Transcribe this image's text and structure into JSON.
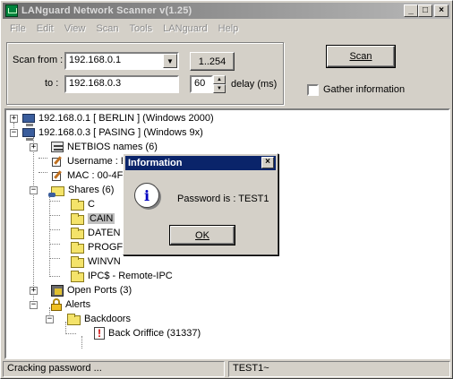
{
  "window": {
    "title": "LANguard Network Scanner v(1.25)"
  },
  "menu": [
    "File",
    "Edit",
    "View",
    "Scan",
    "Tools",
    "LANguard",
    "Help"
  ],
  "scan": {
    "from_label": "Scan from :",
    "from_value": "192.168.0.1",
    "range_button": "1..254",
    "to_label": "to  :",
    "to_value": "192.168.0.3",
    "delay_value": "60",
    "delay_label": "delay (ms)",
    "scan_button": "Scan",
    "gather_label": "Gather information",
    "gather_checked": false
  },
  "tree": {
    "host1": "192.168.0.1  [ BERLIN ]  (Windows 2000)",
    "host2": "192.168.0.3  [ PASING ]  (Windows 9x)",
    "netbios": "NETBIOS names (6)",
    "username": "Username : E",
    "mac": "MAC : 00-4F",
    "shares": "Shares (6)",
    "share_items": [
      "C",
      "CAIN",
      "DATEN",
      "PROGF",
      "WINVN"
    ],
    "ipc": "IPC$   - Remote-IPC",
    "open_ports": "Open Ports (3)",
    "alerts": "Alerts",
    "backdoors": "Backdoors",
    "back_orifice": "Back Oriffice  (31337)"
  },
  "dialog": {
    "title": "Information",
    "message": "Password is : TEST1",
    "ok_button": "OK"
  },
  "status": {
    "left": "Cracking password ...",
    "right": "TEST1~"
  }
}
